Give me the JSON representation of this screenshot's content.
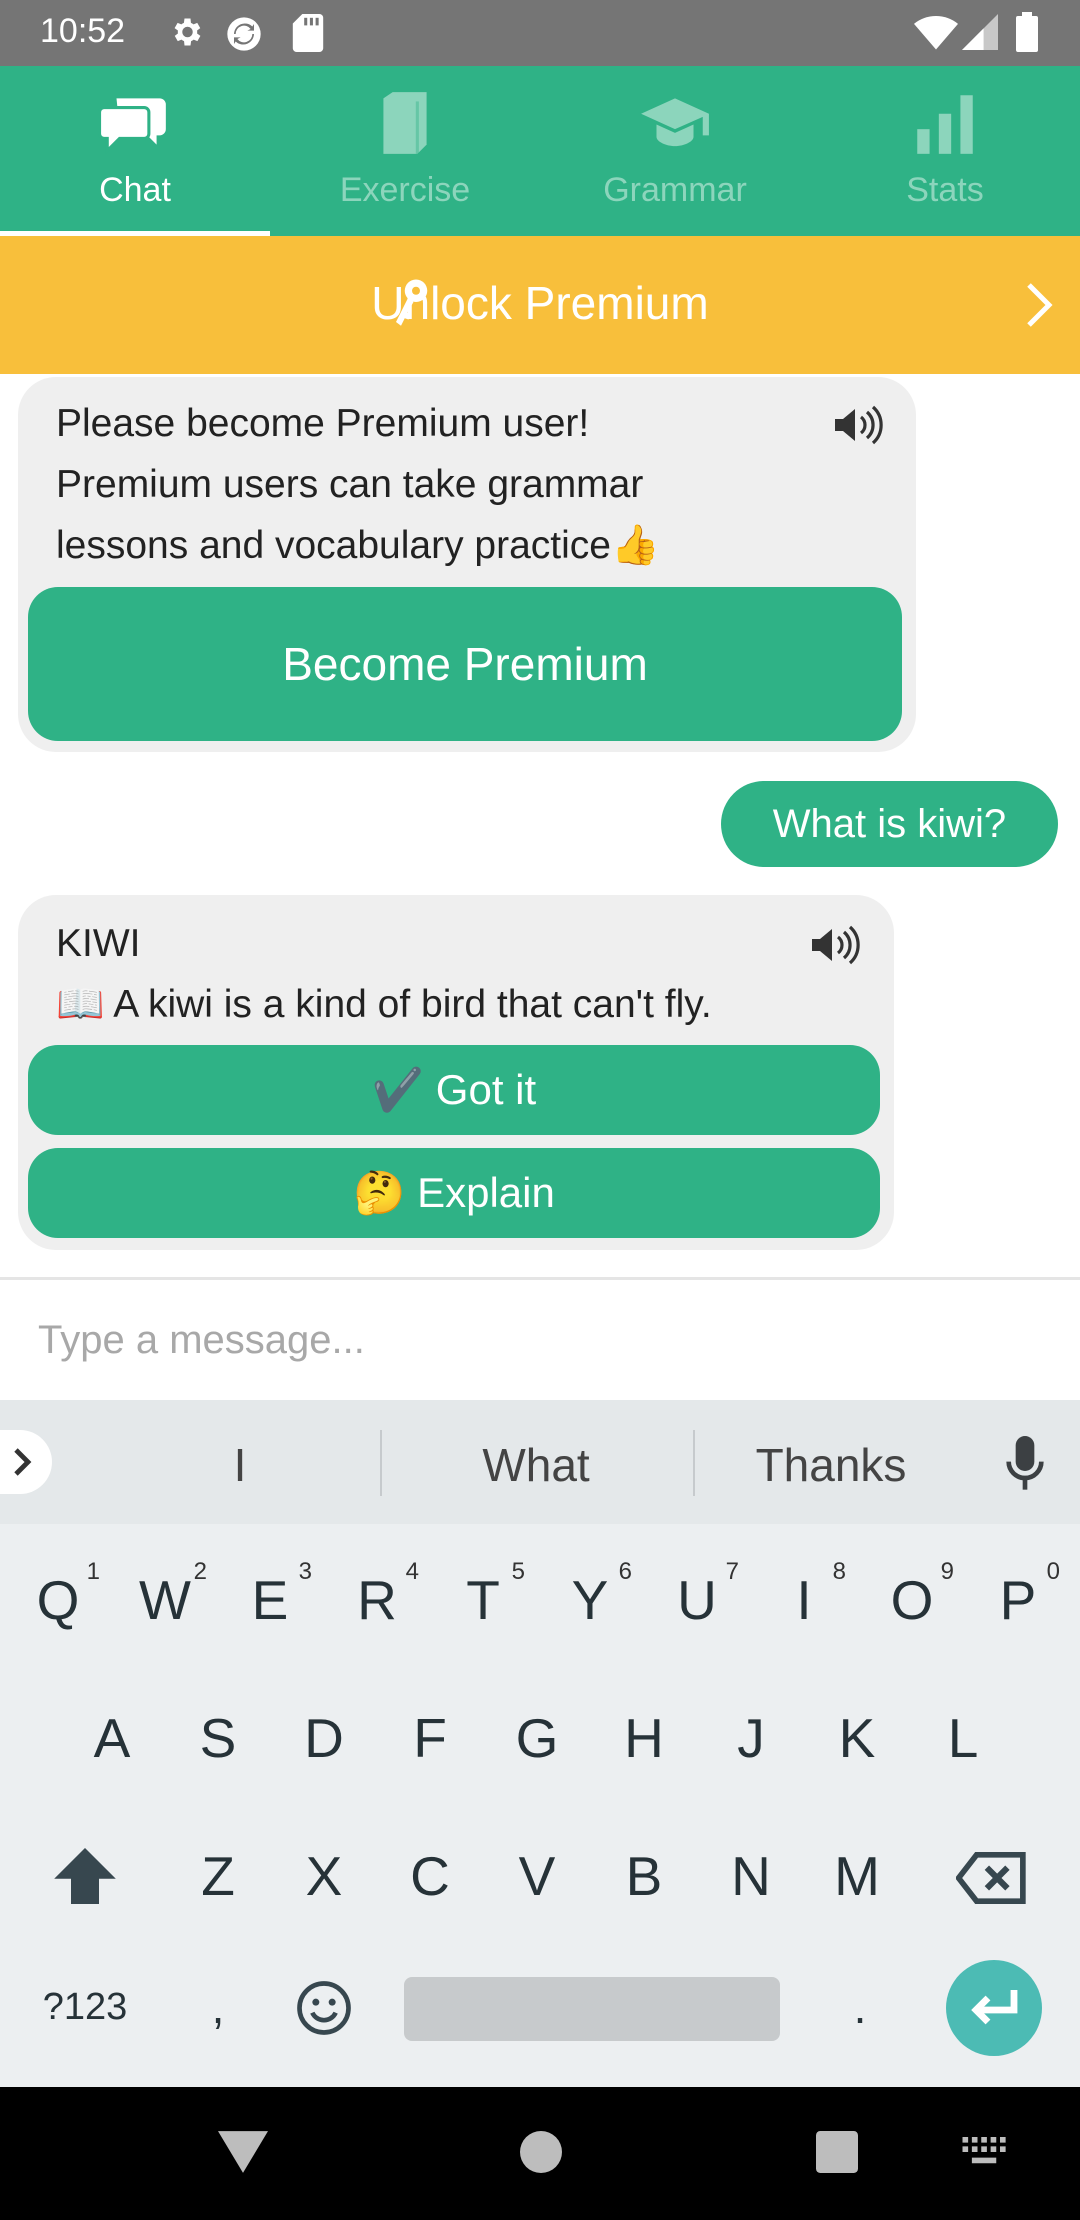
{
  "status_bar": {
    "time": "10:52"
  },
  "tabs": [
    {
      "label": "Chat",
      "active": true
    },
    {
      "label": "Exercise",
      "active": false
    },
    {
      "label": "Grammar",
      "active": false
    },
    {
      "label": "Stats",
      "active": false
    }
  ],
  "premium_banner": {
    "label": "Unlock Premium"
  },
  "messages": {
    "bot1": {
      "lines": [
        "Please become Premium user!",
        "Premium users can take grammar",
        "lessons and vocabulary practice👍"
      ],
      "button": "Become Premium"
    },
    "user1": {
      "text": "What is kiwi?"
    },
    "bot2": {
      "title": "KIWI",
      "definition": "📖 A kiwi is a kind of bird that can't fly.",
      "got_it": "✔️ Got it",
      "explain": "🤔 Explain"
    }
  },
  "composer": {
    "placeholder": "Type a message..."
  },
  "keyboard": {
    "suggestions": [
      "I",
      "What",
      "Thanks"
    ],
    "row1": [
      "Q",
      "W",
      "E",
      "R",
      "T",
      "Y",
      "U",
      "I",
      "O",
      "P"
    ],
    "row1_hints": [
      "1",
      "2",
      "3",
      "4",
      "5",
      "6",
      "7",
      "8",
      "9",
      "0"
    ],
    "row2": [
      "A",
      "S",
      "D",
      "F",
      "G",
      "H",
      "J",
      "K",
      "L"
    ],
    "row3": [
      "Z",
      "X",
      "C",
      "V",
      "B",
      "N",
      "M"
    ],
    "symbols_key": "?123",
    "comma": ",",
    "period": "."
  },
  "colors": {
    "accent": "#2fb286",
    "banner": "#f8bf3b",
    "bubble": "#efefef"
  }
}
